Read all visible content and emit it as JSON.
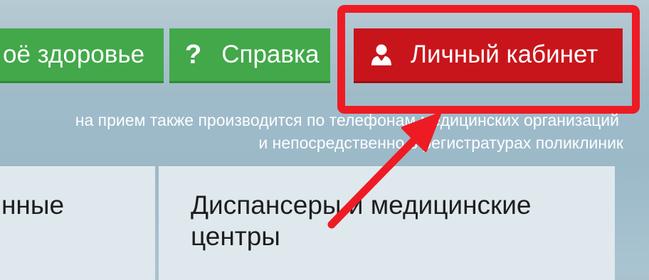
{
  "nav": {
    "health_label": "оё здоровье",
    "help_icon": "?",
    "help_label": "Справка",
    "cabinet_icon": "user-icon",
    "cabinet_label": "Личный кабинет"
  },
  "notice": {
    "line1": "на прием также производится по телефонам медицинских организаций",
    "line2": "и непосредственно в регистратурах поликлиник"
  },
  "cards": [
    {
      "title": "нные"
    },
    {
      "title_line1": "Диспансеры и медицинские",
      "title_line2": "центры"
    }
  ],
  "colors": {
    "green_button": "#42a84a",
    "red_button": "#c8151b",
    "highlight": "#ee1b24",
    "background": "#a3bfcd"
  }
}
